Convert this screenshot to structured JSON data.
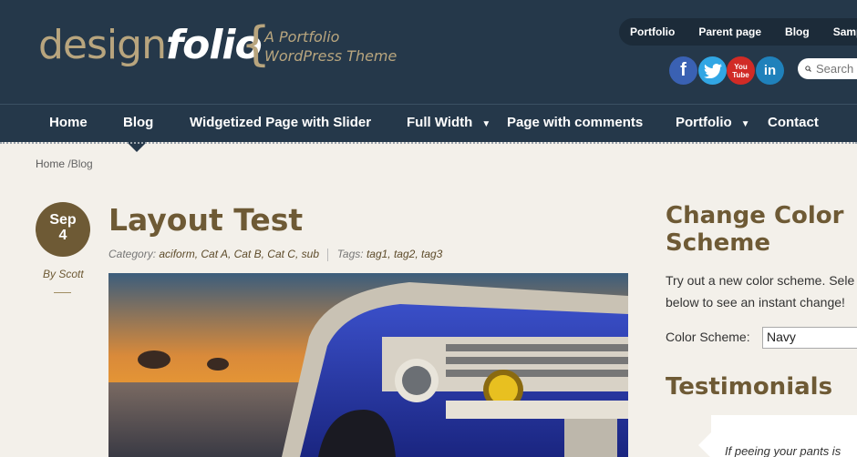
{
  "site": {
    "logo_part1": "design",
    "logo_part2": "folio",
    "brace": "{",
    "tagline_line1": "A Portfolio",
    "tagline_line2": "WordPress Theme"
  },
  "top_menu": [
    "Portfolio",
    "Parent page",
    "Blog",
    "Samp"
  ],
  "social": [
    {
      "name": "facebook-icon",
      "glyph": "f",
      "color": "#3a61b3"
    },
    {
      "name": "twitter-icon",
      "glyph": "t",
      "color": "#31a6e4"
    },
    {
      "name": "youtube-icon",
      "glyph": "You Tube",
      "color": "#d12b26"
    },
    {
      "name": "linkedin-icon",
      "glyph": "in",
      "color": "#1f81bb"
    }
  ],
  "search": {
    "placeholder": "Search"
  },
  "nav": [
    {
      "label": "Home",
      "has_dropdown": false
    },
    {
      "label": "Blog",
      "has_dropdown": false,
      "active": true
    },
    {
      "label": "Widgetized Page with Slider",
      "has_dropdown": false
    },
    {
      "label": "Full Width",
      "has_dropdown": true
    },
    {
      "label": "Page with comments",
      "has_dropdown": false
    },
    {
      "label": "Portfolio",
      "has_dropdown": true
    },
    {
      "label": "Contact",
      "has_dropdown": false
    }
  ],
  "breadcrumb": {
    "home": "Home",
    "separator": "/",
    "current": "Blog"
  },
  "post": {
    "month": "Sep",
    "day": "4",
    "author": "By Scott",
    "title": "Layout Test",
    "category_label": "Category:",
    "categories": "aciform, Cat A, Cat B, Cat C, sub",
    "tags_label": "Tags:",
    "tags": "tag1, tag2, tag3"
  },
  "sidebar": {
    "color_title_line1": "Change Color",
    "color_title_line2": "Scheme",
    "color_text_line1": "Try out a new color scheme. Sele",
    "color_text_line2": "below to see an instant change!",
    "scheme_label": "Color Scheme:",
    "scheme_value": "Navy",
    "testimonials_title": "Testimonials",
    "testimonial_text": "If peeing your pants is"
  },
  "colors": {
    "header_bg": "#25384a",
    "accent": "#6e5a35",
    "logo_gold": "#b8a57e",
    "page_bg": "#f3f0ea"
  }
}
